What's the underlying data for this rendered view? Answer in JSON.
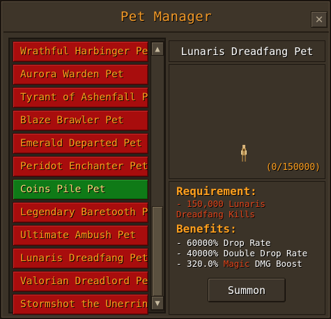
{
  "window": {
    "title": "Pet Manager",
    "close_icon": "close-icon"
  },
  "pet_list": {
    "items": [
      {
        "label": "Wrathful Harbinger Pet",
        "selected": false
      },
      {
        "label": "Aurora Warden Pet",
        "selected": false
      },
      {
        "label": "Tyrant of Ashenfall Pet",
        "selected": false
      },
      {
        "label": "Blaze Brawler Pet",
        "selected": false
      },
      {
        "label": "Emerald Departed Pet",
        "selected": false
      },
      {
        "label": "Peridot Enchanter Pet",
        "selected": false
      },
      {
        "label": "Coins Pile Pet",
        "selected": true
      },
      {
        "label": "Legendary Baretooth Pet",
        "selected": false
      },
      {
        "label": "Ultimate Ambush Pet",
        "selected": false
      },
      {
        "label": "Lunaris Dreadfang Pet",
        "selected": false
      },
      {
        "label": "Valorian Dreadlord Pet",
        "selected": false
      },
      {
        "label": "Stormshot the Unerring Pet",
        "selected": false
      }
    ]
  },
  "details": {
    "pet_name": "Lunaris Dreadfang Pet",
    "kill_progress": "(0/150000)",
    "requirement_heading": "Requirement:",
    "requirement_line1": "- 150,000 Lunaris",
    "requirement_line2": "Dreadfang Kills",
    "benefits_heading": "Benefits:",
    "benefit_1": "- 60000% Drop Rate",
    "benefit_2": "- 40000% Double Drop Rate",
    "benefit_3_prefix": "- 320.0% ",
    "benefit_3_magic": "Magic",
    "benefit_3_suffix": " DMG Boost",
    "summon_label": "Summon"
  },
  "colors": {
    "title_orange": "#f39a28",
    "item_red": "#a80d0d",
    "item_green": "#0f7a17",
    "requirement_red": "#e2461c"
  }
}
